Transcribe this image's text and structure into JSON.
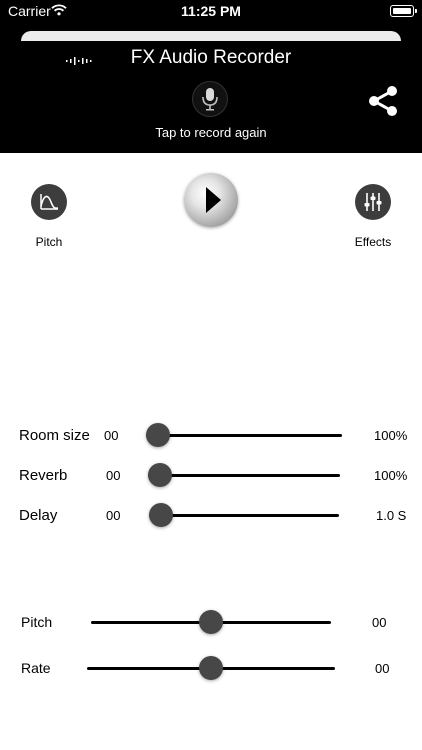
{
  "status_bar": {
    "carrier": "Carrier",
    "time": "11:25 PM"
  },
  "header": {
    "title": "FX Audio Recorder",
    "record_caption": "Tap to record again"
  },
  "controls": {
    "pitch_label": "Pitch",
    "effects_label": "Effects"
  },
  "effect_sliders": [
    {
      "label": "Room size",
      "min_value": "00",
      "max_value": "100%",
      "level": 0.0
    },
    {
      "label": "Reverb",
      "min_value": "00",
      "max_value": "100%",
      "level": 0.0
    },
    {
      "label": "Delay",
      "min_value": "00",
      "max_value": "1.0 S",
      "level": 0.0
    }
  ],
  "tune_sliders": [
    {
      "label": "Pitch",
      "value": "00",
      "level": 0.5
    },
    {
      "label": "Rate",
      "value": "00",
      "level": 0.5
    }
  ],
  "colors": {
    "header_bg": "#000000",
    "thumb": "#474747",
    "button_bg": "#3d3d3d"
  },
  "icons": [
    "wifi-icon",
    "battery-icon",
    "waveform-icon",
    "microphone-icon",
    "share-icon",
    "pitch-curve-icon",
    "play-icon",
    "equalizer-icon"
  ]
}
